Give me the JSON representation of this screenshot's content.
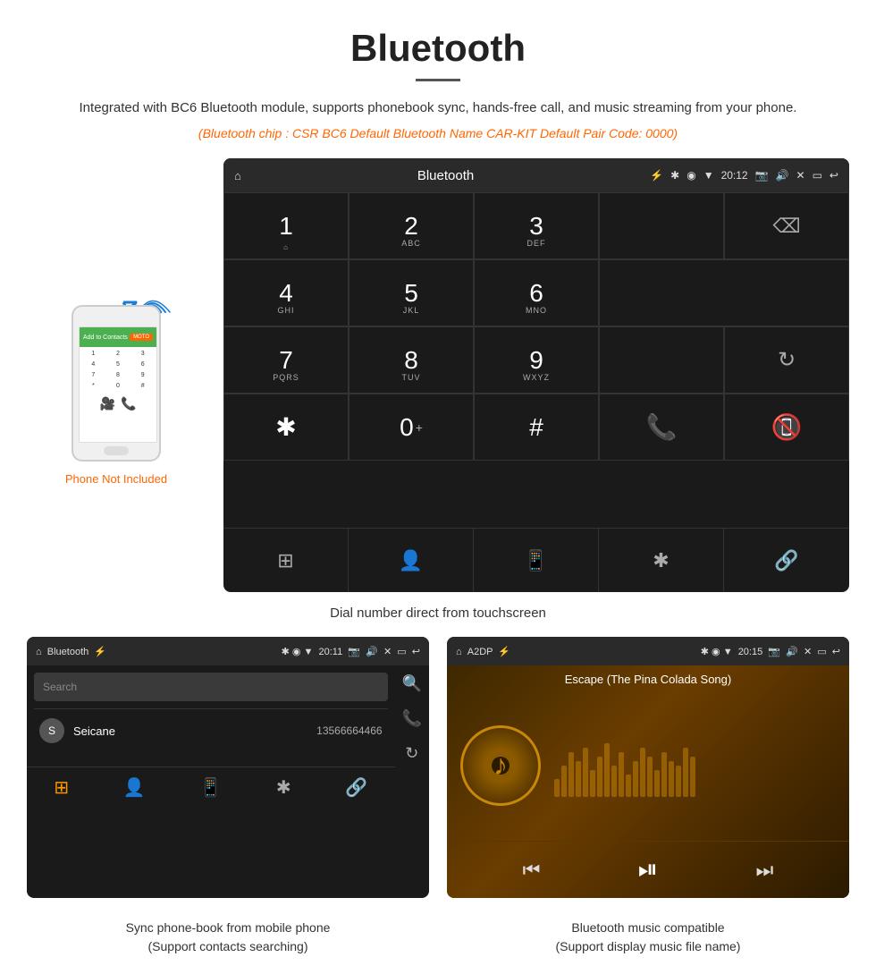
{
  "header": {
    "title": "Bluetooth",
    "description": "Integrated with BC6 Bluetooth module, supports phonebook sync, hands-free call, and music streaming from your phone.",
    "specs": "(Bluetooth chip : CSR BC6    Default Bluetooth Name CAR-KIT    Default Pair Code: 0000)"
  },
  "phone_note": "Phone Not Included",
  "dial_screen": {
    "statusbar": {
      "left_icon": "⌂",
      "center": "Bluetooth",
      "usb_icon": "⚡",
      "time": "20:12",
      "camera_icon": "📷",
      "volume_icon": "🔊",
      "close_icon": "✕",
      "screen_icon": "▭",
      "back_icon": "↩"
    },
    "keypad": [
      {
        "main": "1",
        "sub": "",
        "extra": "⌂"
      },
      {
        "main": "2",
        "sub": "ABC"
      },
      {
        "main": "3",
        "sub": "DEF"
      },
      {
        "main": "",
        "sub": "",
        "wide": true
      },
      {
        "main": "backspace"
      },
      {
        "main": "4",
        "sub": "GHI"
      },
      {
        "main": "5",
        "sub": "JKL"
      },
      {
        "main": "6",
        "sub": "MNO"
      },
      {
        "main": "",
        "wide": true
      },
      {
        "main": ""
      },
      {
        "main": "7",
        "sub": "PQRS"
      },
      {
        "main": "8",
        "sub": "TUV"
      },
      {
        "main": "9",
        "sub": "WXYZ"
      },
      {
        "main": "",
        "wide": true
      },
      {
        "main": "refresh"
      },
      {
        "main": "*"
      },
      {
        "main": "0+"
      },
      {
        "main": "#"
      },
      {
        "main": "call_green"
      },
      {
        "main": ""
      },
      {
        "main": "call_red"
      }
    ],
    "nav": [
      "grid",
      "person",
      "phone",
      "bluetooth",
      "link"
    ]
  },
  "dial_caption": "Dial number direct from touchscreen",
  "contacts_panel": {
    "statusbar_left": "⌂  Bluetooth  ⚡",
    "statusbar_right": "✱ ◉ ▼  20:11  📷  🔊  ✕  ▭  ↩",
    "search_placeholder": "Search",
    "contacts": [
      {
        "initial": "S",
        "name": "Seicane",
        "number": "13566664466"
      }
    ],
    "nav_items": [
      "grid",
      "person",
      "phone",
      "bluetooth",
      "link"
    ]
  },
  "music_panel": {
    "statusbar_left": "⌂  A2DP  ⚡",
    "statusbar_right": "✱ ◉ ▼  20:15  📷  🔊  ✕  ▭  ↩",
    "song_title": "Escape (The Pina Colada Song)",
    "controls": [
      "prev",
      "play_pause",
      "next"
    ],
    "waveform_heights": [
      20,
      35,
      50,
      40,
      55,
      30,
      45,
      60,
      35,
      50,
      25,
      40,
      55,
      45,
      30,
      50,
      40,
      35,
      55,
      45
    ]
  },
  "captions": {
    "contacts": "Sync phone-book from mobile phone\n(Support contacts searching)",
    "music": "Bluetooth music compatible\n(Support display music file name)"
  }
}
